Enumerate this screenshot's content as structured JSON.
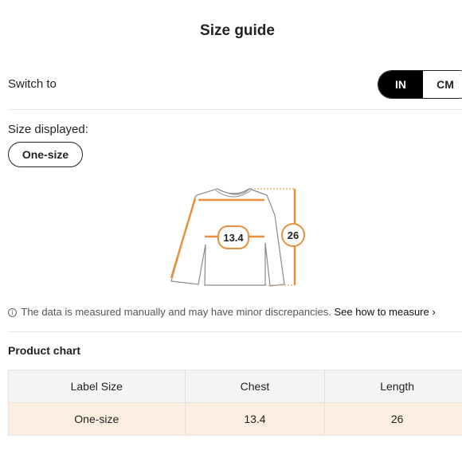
{
  "header": {
    "title": "Size guide"
  },
  "unit_switch": {
    "label": "Switch to",
    "options": [
      "IN",
      "CM"
    ],
    "selected": "IN"
  },
  "size_displayed": {
    "label": "Size displayed:",
    "value": "One-size"
  },
  "diagram": {
    "chest_value": "13.4",
    "length_value": "26",
    "accent_color": "#e8903e"
  },
  "note": {
    "icon": "info-icon",
    "text": "The data is measured manually and may have minor discrepancies.",
    "link_text": "See how to measure",
    "chevron": "›"
  },
  "product_chart": {
    "title": "Product chart",
    "columns": [
      "Label Size",
      "Chest",
      "Length"
    ],
    "rows": [
      [
        "One-size",
        "13.4",
        "26"
      ]
    ]
  }
}
